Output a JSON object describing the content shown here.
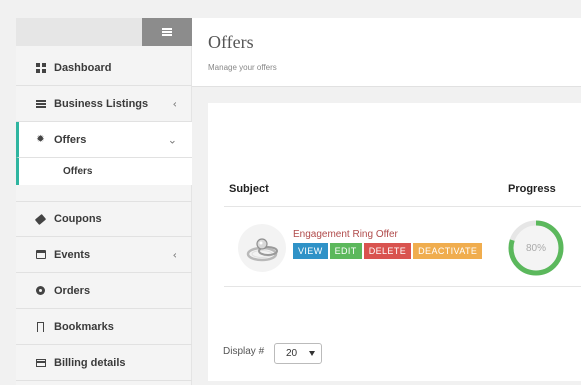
{
  "sidebar": {
    "items": [
      {
        "label": "Dashboard",
        "icon": "dashboard-icon"
      },
      {
        "label": "Business Listings",
        "icon": "list-icon"
      },
      {
        "label": "Offers",
        "icon": "gear-icon",
        "expanded": true
      },
      {
        "label": "Coupons",
        "icon": "tag-icon"
      },
      {
        "label": "Events",
        "icon": "calendar-icon"
      },
      {
        "label": "Orders",
        "icon": "gear-icon"
      },
      {
        "label": "Bookmarks",
        "icon": "bookmark-icon"
      },
      {
        "label": "Billing details",
        "icon": "card-icon"
      }
    ],
    "sub_item": "Offers",
    "accent": "#2fb5a0"
  },
  "header": {
    "title": "Offers",
    "subtitle": "Manage your offers"
  },
  "table": {
    "columns": [
      "Subject",
      "Progress"
    ],
    "rows": [
      {
        "subject": "Engagement Ring Offer",
        "progress": 80,
        "progress_label": "80%",
        "actions": [
          "VIEW",
          "EDIT",
          "DELETE",
          "DEACTIVATE"
        ]
      }
    ]
  },
  "display": {
    "label": "Display #",
    "value": "20"
  }
}
